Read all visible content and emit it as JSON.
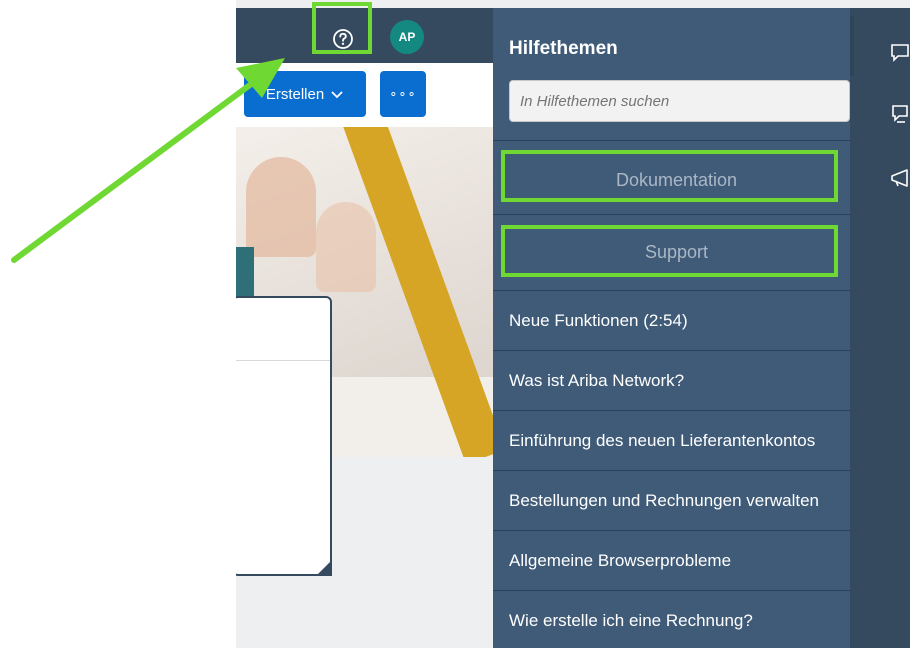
{
  "topbar": {
    "help_icon": "question-circle-icon",
    "avatar_initials": "AP"
  },
  "toolbar": {
    "create_label": "Erstellen",
    "create_chevron": "chevron-down-icon",
    "more_label": "∘∘∘"
  },
  "help_panel": {
    "title": "Hilfethemen",
    "search_placeholder": "In Hilfethemen suchen",
    "documentation_label": "Dokumentation",
    "support_label": "Support",
    "topics": [
      "Neue Funktionen (2:54)",
      "Was ist Ariba Network?",
      "Einführung des neuen Lieferantenkontos",
      "Bestellungen und Rechnungen verwalten",
      "Allgemeine Browserprobleme",
      "Wie erstelle ich eine Rechnung?"
    ]
  },
  "right_rail": {
    "icons": [
      "chat-icon",
      "feedback-icon",
      "megaphone-icon"
    ]
  },
  "colors": {
    "shell_bar": "#354a5f",
    "panel_bg": "#3f5b78",
    "primary_button": "#0a6ed1",
    "avatar": "#148982",
    "annotation_highlight": "#6fd832"
  }
}
